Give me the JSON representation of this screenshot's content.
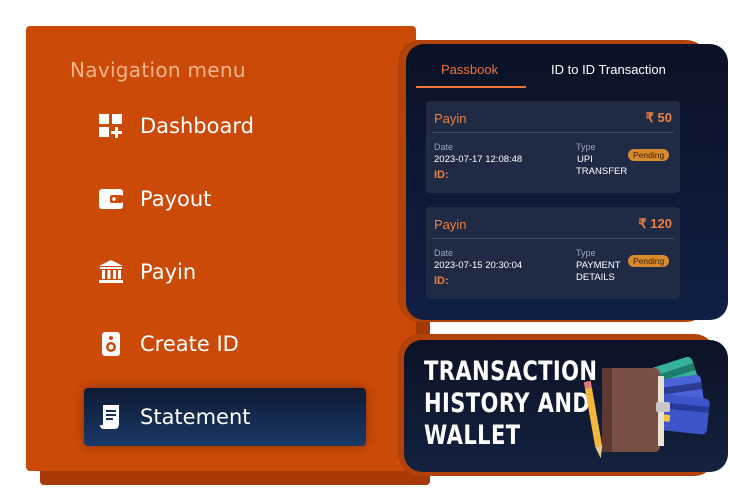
{
  "nav": {
    "title": "Navigation menu",
    "items": [
      {
        "label": "Dashboard",
        "icon": "dashboard-icon"
      },
      {
        "label": "Payout",
        "icon": "wallet-icon"
      },
      {
        "label": "Payin",
        "icon": "bank-icon"
      },
      {
        "label": "Create ID",
        "icon": "id-device-icon"
      },
      {
        "label": "Statement",
        "icon": "receipt-icon",
        "active": true
      }
    ]
  },
  "passbook": {
    "tabs": [
      {
        "label": "Passbook",
        "active": true
      },
      {
        "label": "ID to ID Transaction",
        "active": false
      }
    ],
    "cards": [
      {
        "type": "Payin",
        "amount": "₹ 50",
        "date_label": "Date",
        "date": "2023-07-17 12:08:48",
        "id_label": "ID:",
        "type_label": "Type",
        "type_value_line1": "UPI",
        "type_value_line2": "TRANSFER",
        "status": "Pending"
      },
      {
        "type": "Payin",
        "amount": "₹ 120",
        "date_label": "Date",
        "date": "2023-07-15 20:30:04",
        "id_label": "ID:",
        "type_label": "Type",
        "type_value_line1": "PAYMENT",
        "type_value_line2": "DETAILS",
        "status": "Pending"
      }
    ]
  },
  "promo": {
    "line1": "TRANSACTION",
    "line2": "HISTORY AND",
    "line3": "WALLET"
  },
  "colors": {
    "nav_orange": "#cc4a08",
    "accent_orange": "#f0743a",
    "dark_navy": "#0b1226",
    "card_bg": "#1f2a45",
    "pending_badge": "#d98a2e"
  }
}
